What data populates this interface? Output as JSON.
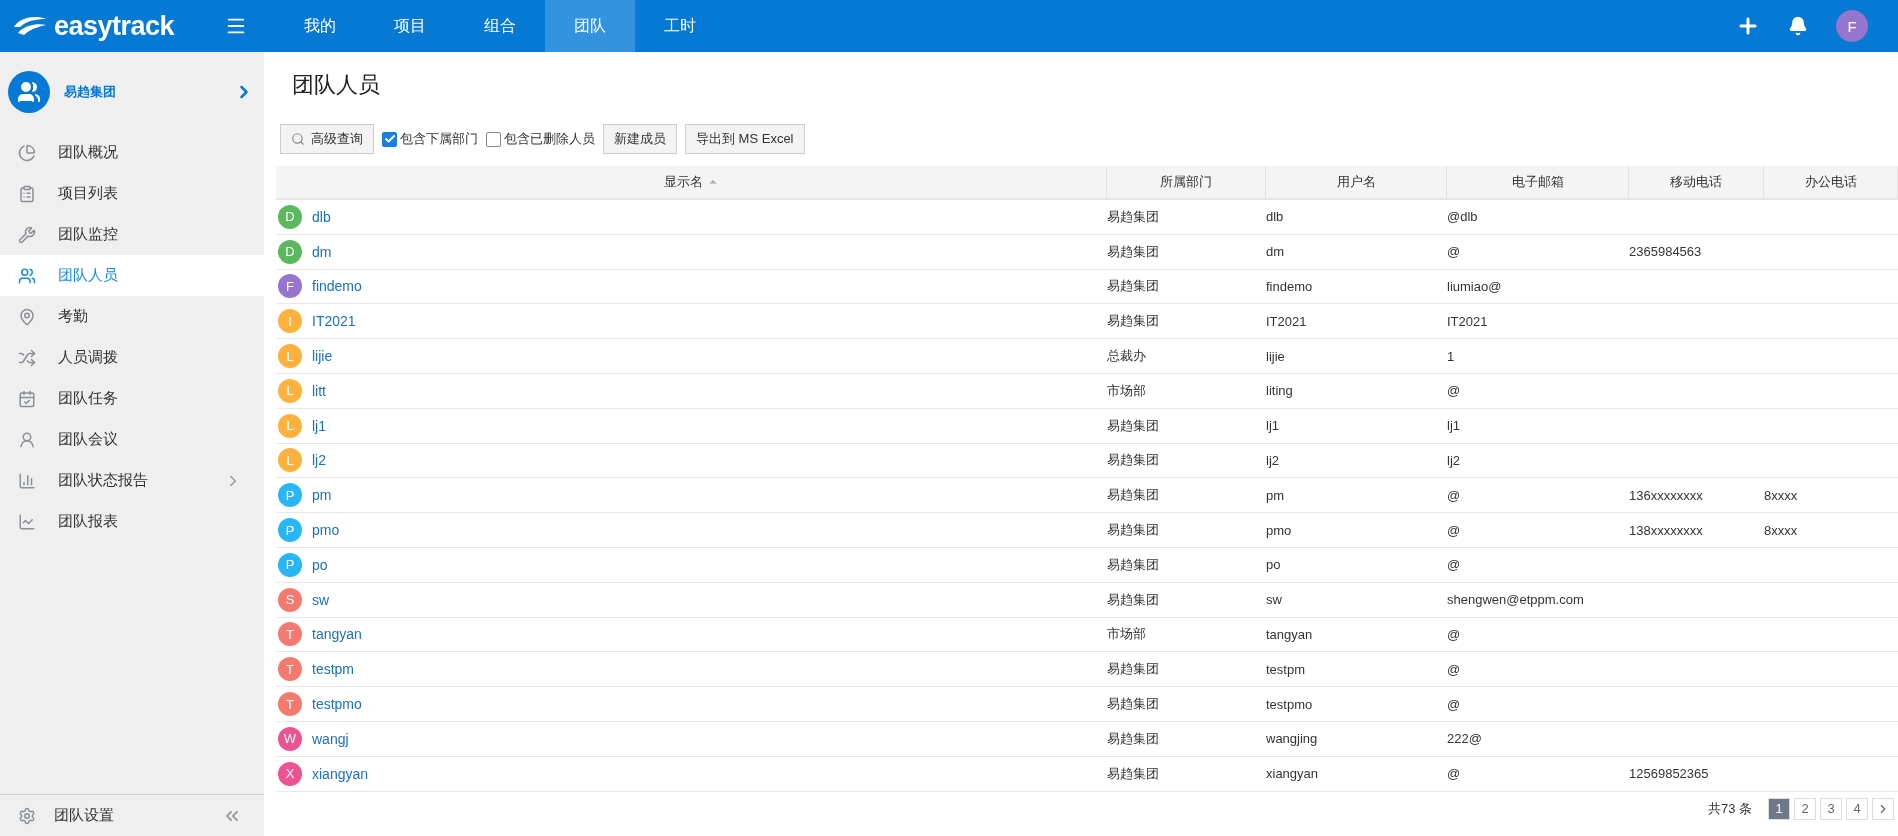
{
  "topbar": {
    "logo": "easytrack",
    "nav": [
      {
        "label": "我的",
        "selected": false
      },
      {
        "label": "项目",
        "selected": false
      },
      {
        "label": "组合",
        "selected": false
      },
      {
        "label": "团队",
        "selected": true
      },
      {
        "label": "工时",
        "selected": false
      }
    ],
    "user_avatar": "F"
  },
  "sidebar": {
    "group": "易趋集团",
    "items": [
      {
        "label": "团队概况",
        "selected": false,
        "expandable": false
      },
      {
        "label": "项目列表",
        "selected": false,
        "expandable": false
      },
      {
        "label": "团队监控",
        "selected": false,
        "expandable": false
      },
      {
        "label": "团队人员",
        "selected": true,
        "expandable": false
      },
      {
        "label": "考勤",
        "selected": false,
        "expandable": false
      },
      {
        "label": "人员调拨",
        "selected": false,
        "expandable": false
      },
      {
        "label": "团队任务",
        "selected": false,
        "expandable": false
      },
      {
        "label": "团队会议",
        "selected": false,
        "expandable": false
      },
      {
        "label": "团队状态报告",
        "selected": false,
        "expandable": true
      },
      {
        "label": "团队报表",
        "selected": false,
        "expandable": false
      }
    ],
    "footer": "团队设置"
  },
  "page_title": "团队人员",
  "toolbar": {
    "search_button": "高级查询",
    "checkboxes": [
      {
        "label": "包含下属部门",
        "checked": true
      },
      {
        "label": "包含已删除人员",
        "checked": false
      }
    ],
    "buttons": [
      "新建成员",
      "导出到 MS Excel"
    ]
  },
  "table": {
    "columns": [
      {
        "label": "显示名",
        "sorted": true
      },
      {
        "label": "所属部门",
        "sorted": false
      },
      {
        "label": "用户名",
        "sorted": false
      },
      {
        "label": "电子邮箱",
        "sorted": false
      },
      {
        "label": "移动电话",
        "sorted": false
      },
      {
        "label": "办公电话",
        "sorted": false
      }
    ],
    "rows": [
      {
        "avatar": "D",
        "color": "#5cb85c",
        "name": "dlb",
        "dept": "易趋集团",
        "username": "dlb",
        "email": "@dlb",
        "mobile": "",
        "office": ""
      },
      {
        "avatar": "D",
        "color": "#5cb85c",
        "name": "dm",
        "dept": "易趋集团",
        "username": "dm",
        "email": "@",
        "mobile": "2365984563",
        "office": ""
      },
      {
        "avatar": "F",
        "color": "#9575cd",
        "name": "findemo",
        "dept": "易趋集团",
        "username": "findemo",
        "email": "liumiao@",
        "mobile": "",
        "office": ""
      },
      {
        "avatar": "I",
        "color": "#ffb13d",
        "name": "IT2021",
        "dept": "易趋集团",
        "username": "IT2021",
        "email": "IT2021",
        "mobile": "",
        "office": ""
      },
      {
        "avatar": "L",
        "color": "#ffb13d",
        "name": "lijie",
        "dept": "总裁办",
        "username": "lijie",
        "email": "1",
        "mobile": "",
        "office": ""
      },
      {
        "avatar": "L",
        "color": "#ffb13d",
        "name": "litt",
        "dept": "市场部",
        "username": "liting",
        "email": "@",
        "mobile": "",
        "office": ""
      },
      {
        "avatar": "L",
        "color": "#ffb13d",
        "name": "lj1",
        "dept": "易趋集团",
        "username": "lj1",
        "email": "lj1",
        "mobile": "",
        "office": ""
      },
      {
        "avatar": "L",
        "color": "#ffb13d",
        "name": "lj2",
        "dept": "易趋集团",
        "username": "lj2",
        "email": "lj2",
        "mobile": "",
        "office": ""
      },
      {
        "avatar": "P",
        "color": "#29b6f6",
        "name": "pm",
        "dept": "易趋集团",
        "username": "pm",
        "email": "@",
        "mobile": "136xxxxxxxx",
        "office": "8xxxx"
      },
      {
        "avatar": "P",
        "color": "#29b6f6",
        "name": "pmo",
        "dept": "易趋集团",
        "username": "pmo",
        "email": "@",
        "mobile": "138xxxxxxxx",
        "office": "8xxxx"
      },
      {
        "avatar": "P",
        "color": "#29b6f6",
        "name": "po",
        "dept": "易趋集团",
        "username": "po",
        "email": "@",
        "mobile": "",
        "office": ""
      },
      {
        "avatar": "S",
        "color": "#f4796f",
        "name": "sw",
        "dept": "易趋集团",
        "username": "sw",
        "email": "shengwen@etppm.com",
        "mobile": "",
        "office": ""
      },
      {
        "avatar": "T",
        "color": "#f4796f",
        "name": "tangyan",
        "dept": "市场部",
        "username": "tangyan",
        "email": "@",
        "mobile": "",
        "office": ""
      },
      {
        "avatar": "T",
        "color": "#f4796f",
        "name": "testpm",
        "dept": "易趋集团",
        "username": "testpm",
        "email": "@",
        "mobile": "",
        "office": ""
      },
      {
        "avatar": "T",
        "color": "#f4796f",
        "name": "testpmo",
        "dept": "易趋集团",
        "username": "testpmo",
        "email": "@",
        "mobile": "",
        "office": ""
      },
      {
        "avatar": "W",
        "color": "#ec5391",
        "name": "wangj",
        "dept": "易趋集团",
        "username": "wangjing",
        "email": "222@",
        "mobile": "",
        "office": ""
      },
      {
        "avatar": "X",
        "color": "#ec5391",
        "name": "xiangyan",
        "dept": "易趋集团",
        "username": "xiangyan",
        "email": "@",
        "mobile": "12569852365",
        "office": ""
      }
    ]
  },
  "pagination": {
    "total": "共73 条",
    "pages": [
      {
        "label": "1",
        "selected": true
      },
      {
        "label": "2",
        "selected": false
      },
      {
        "label": "3",
        "selected": false
      },
      {
        "label": "4",
        "selected": false
      }
    ]
  }
}
